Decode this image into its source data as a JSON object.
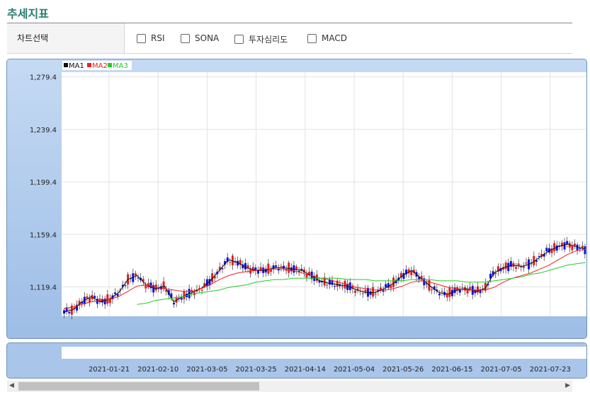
{
  "title": "추세지표",
  "options": {
    "label": "차트선택",
    "items": [
      {
        "label": "RSI"
      },
      {
        "label": "SONA"
      },
      {
        "label": "투자심리도"
      },
      {
        "label": "MACD"
      }
    ]
  },
  "legend": [
    "MA1",
    "MA2",
    "MA3"
  ],
  "colors": {
    "up": "#e02020",
    "down": "#1010e0",
    "ma1": "#111111",
    "ma2": "#ee2020",
    "ma3": "#22cc22",
    "frame": "#a9c6ea"
  },
  "chart_data": {
    "type": "candlestick",
    "y_ticks": [
      "1,279.4",
      "1,239.4",
      "1,199.4",
      "1,159.4",
      "1,119.4"
    ],
    "ylim": [
      1097,
      1283
    ],
    "x_ticks": [
      "2021-01-21",
      "2021-02-10",
      "2021-03-05",
      "2021-03-25",
      "2021-04-14",
      "2021-05-04",
      "2021-05-26",
      "2021-06-15",
      "2021-07-05",
      "2021-07-23"
    ],
    "series": [
      {
        "name": "MA1",
        "values": [
          1100,
          1102,
          1108,
          1112,
          1108,
          1110,
          1115,
          1125,
          1128,
          1121,
          1118,
          1120,
          1108,
          1112,
          1115,
          1118,
          1124,
          1132,
          1140,
          1138,
          1134,
          1132,
          1132,
          1134,
          1134,
          1133,
          1132,
          1128,
          1124,
          1122,
          1121,
          1120,
          1117,
          1115,
          1115,
          1118,
          1122,
          1128,
          1132,
          1126,
          1120,
          1115,
          1114,
          1117,
          1118,
          1116,
          1118,
          1130,
          1134,
          1136,
          1135,
          1137,
          1142,
          1147,
          1150,
          1152,
          1150,
          1148
        ]
      },
      {
        "name": "MA2",
        "values": [
          1103,
          1104,
          1106,
          1108,
          1109,
          1110,
          1112,
          1116,
          1120,
          1121,
          1119,
          1118,
          1117,
          1116,
          1116,
          1118,
          1121,
          1125,
          1128,
          1130,
          1131,
          1132,
          1133,
          1133,
          1133,
          1132,
          1130,
          1128,
          1126,
          1125,
          1123,
          1121,
          1119,
          1118,
          1117,
          1117,
          1118,
          1120,
          1123,
          1124,
          1123,
          1121,
          1119,
          1118,
          1117,
          1117,
          1117,
          1119,
          1123,
          1126,
          1128,
          1130,
          1133,
          1136,
          1140,
          1144,
          1147,
          1148
        ]
      },
      {
        "name": "MA3",
        "values": [
          null,
          null,
          null,
          null,
          null,
          null,
          null,
          null,
          1106,
          1107,
          1109,
          1110,
          1111,
          1112,
          1114,
          1115,
          1116,
          1117,
          1119,
          1120,
          1121,
          1123,
          1124,
          1125,
          1125,
          1126,
          1126,
          1126,
          1126,
          1126,
          1126,
          1125,
          1125,
          1125,
          1124,
          1124,
          1124,
          1124,
          1125,
          1125,
          1125,
          1124,
          1124,
          1124,
          1123,
          1123,
          1123,
          1124,
          1125,
          1126,
          1127,
          1129,
          1130,
          1132,
          1134,
          1136,
          1137,
          1138
        ]
      }
    ]
  },
  "scrollbar": {
    "left": "◀",
    "right": "▶"
  }
}
